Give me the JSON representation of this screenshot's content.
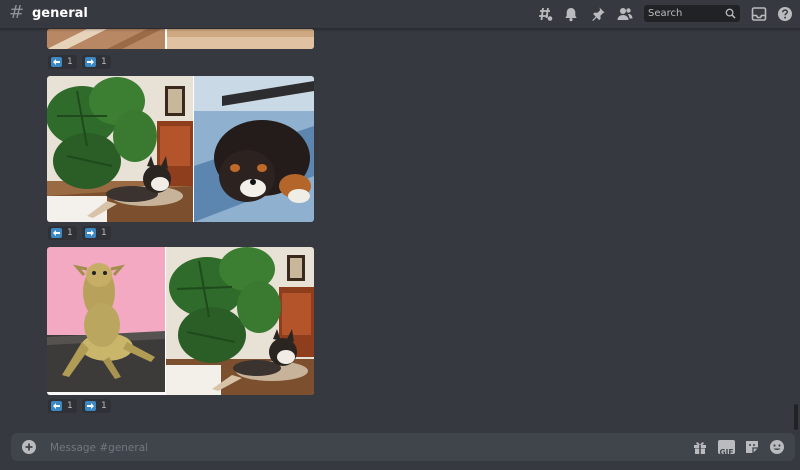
{
  "header": {
    "hash": "#",
    "channel_name": "general",
    "icons": [
      "threads-icon",
      "bell-icon",
      "pin-icon",
      "members-icon",
      "inbox-icon",
      "help-icon"
    ],
    "search_placeholder": "Search"
  },
  "messages": [
    {
      "image_type": "gallery-top-partial",
      "reactions": [
        {
          "emoji": "left-arrow-emoji",
          "count": "1"
        },
        {
          "emoji": "right-arrow-emoji",
          "count": "1"
        }
      ]
    },
    {
      "image_type": "dog-husky-and-bernese-puppy",
      "reactions": [
        {
          "emoji": "left-arrow-emoji",
          "count": "1"
        },
        {
          "emoji": "right-arrow-emoji",
          "count": "1"
        }
      ]
    },
    {
      "image_type": "bearded-dragon-and-husky",
      "reactions": [
        {
          "emoji": "left-arrow-emoji",
          "count": "1"
        },
        {
          "emoji": "right-arrow-emoji",
          "count": "1"
        }
      ]
    }
  ],
  "composer": {
    "placeholder": "Message #general",
    "icons": [
      "add-icon",
      "gift-icon",
      "gif-icon",
      "sticker-icon",
      "emoji-icon"
    ],
    "gif_label": "GIF"
  },
  "colors": {
    "background": "#36393f",
    "reaction_emoji": "#3b88c3",
    "composer": "#40444b"
  }
}
